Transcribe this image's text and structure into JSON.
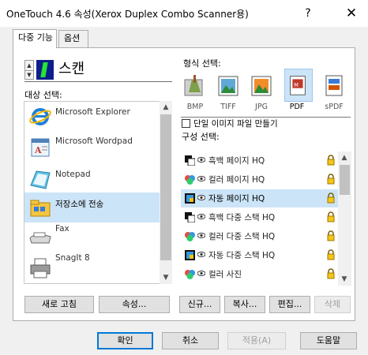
{
  "window": {
    "title": "OneTouch 4.6 속성(Xerox Duplex Combo Scanner용)",
    "help_label": "?",
    "close_label": "✕"
  },
  "tabs": [
    {
      "label": "다중 기능",
      "selected": true
    },
    {
      "label": "옵션",
      "selected": false
    }
  ],
  "scan_mode": {
    "label": "스캔",
    "icon": "scan-mode-icon",
    "spinner_up": "▲",
    "spinner_down": "▼"
  },
  "destination": {
    "title": "대상 선택:",
    "items": [
      {
        "label": "Microsoft Explorer",
        "icon": "internet-explorer-icon",
        "selected": false
      },
      {
        "label": "Microsoft Wordpad",
        "icon": "wordpad-icon",
        "selected": false
      },
      {
        "label": "Notepad",
        "icon": "notepad-icon",
        "selected": false
      },
      {
        "label": "저장소에 전송",
        "icon": "transfer-to-storage-icon",
        "selected": true
      },
      {
        "label": "Fax",
        "icon": "fax-icon",
        "selected": false
      },
      {
        "label": "SnagIt 8",
        "icon": "snagit-printer-icon",
        "selected": false
      }
    ],
    "scroll_up": "▲",
    "scroll_down": "▼"
  },
  "format": {
    "title": "형식 선택:",
    "items": [
      {
        "label": "BMP",
        "icon": "bmp-icon",
        "selected": false
      },
      {
        "label": "TIFF",
        "icon": "tiff-icon",
        "selected": false
      },
      {
        "label": "JPG",
        "icon": "jpg-icon",
        "selected": false
      },
      {
        "label": "PDF",
        "icon": "pdf-icon",
        "selected": true
      },
      {
        "label": "sPDF",
        "icon": "spdf-icon",
        "selected": false
      }
    ]
  },
  "single_image_file": {
    "label": "단일 이미지 파일 만들기",
    "checked": false
  },
  "configuration": {
    "title": "구성 선택:",
    "items": [
      {
        "label": "흑백 페이지 HQ",
        "icon": "black-white-icon",
        "selected": false
      },
      {
        "label": "컬러 페이지 HQ",
        "icon": "color-icon",
        "selected": false
      },
      {
        "label": "자동 페이지 HQ",
        "icon": "auto-color-icon",
        "selected": true
      },
      {
        "label": "흑백 다중 스택 HQ",
        "icon": "black-white-icon",
        "selected": false
      },
      {
        "label": "컬러 다중 스택 HQ",
        "icon": "color-icon",
        "selected": false
      },
      {
        "label": "자동 다중 스택 HQ",
        "icon": "auto-color-icon",
        "selected": false
      },
      {
        "label": "컬러 사진",
        "icon": "color-icon",
        "selected": false
      }
    ],
    "scroll_up": "▲",
    "scroll_down": "▼"
  },
  "buttons": {
    "refresh": "새로 고침",
    "properties": "속성...",
    "new": "신규...",
    "copy": "복사...",
    "edit": "편집...",
    "delete": "삭제",
    "ok": "확인",
    "cancel": "취소",
    "apply": "적용(A)",
    "help": "도움말"
  }
}
